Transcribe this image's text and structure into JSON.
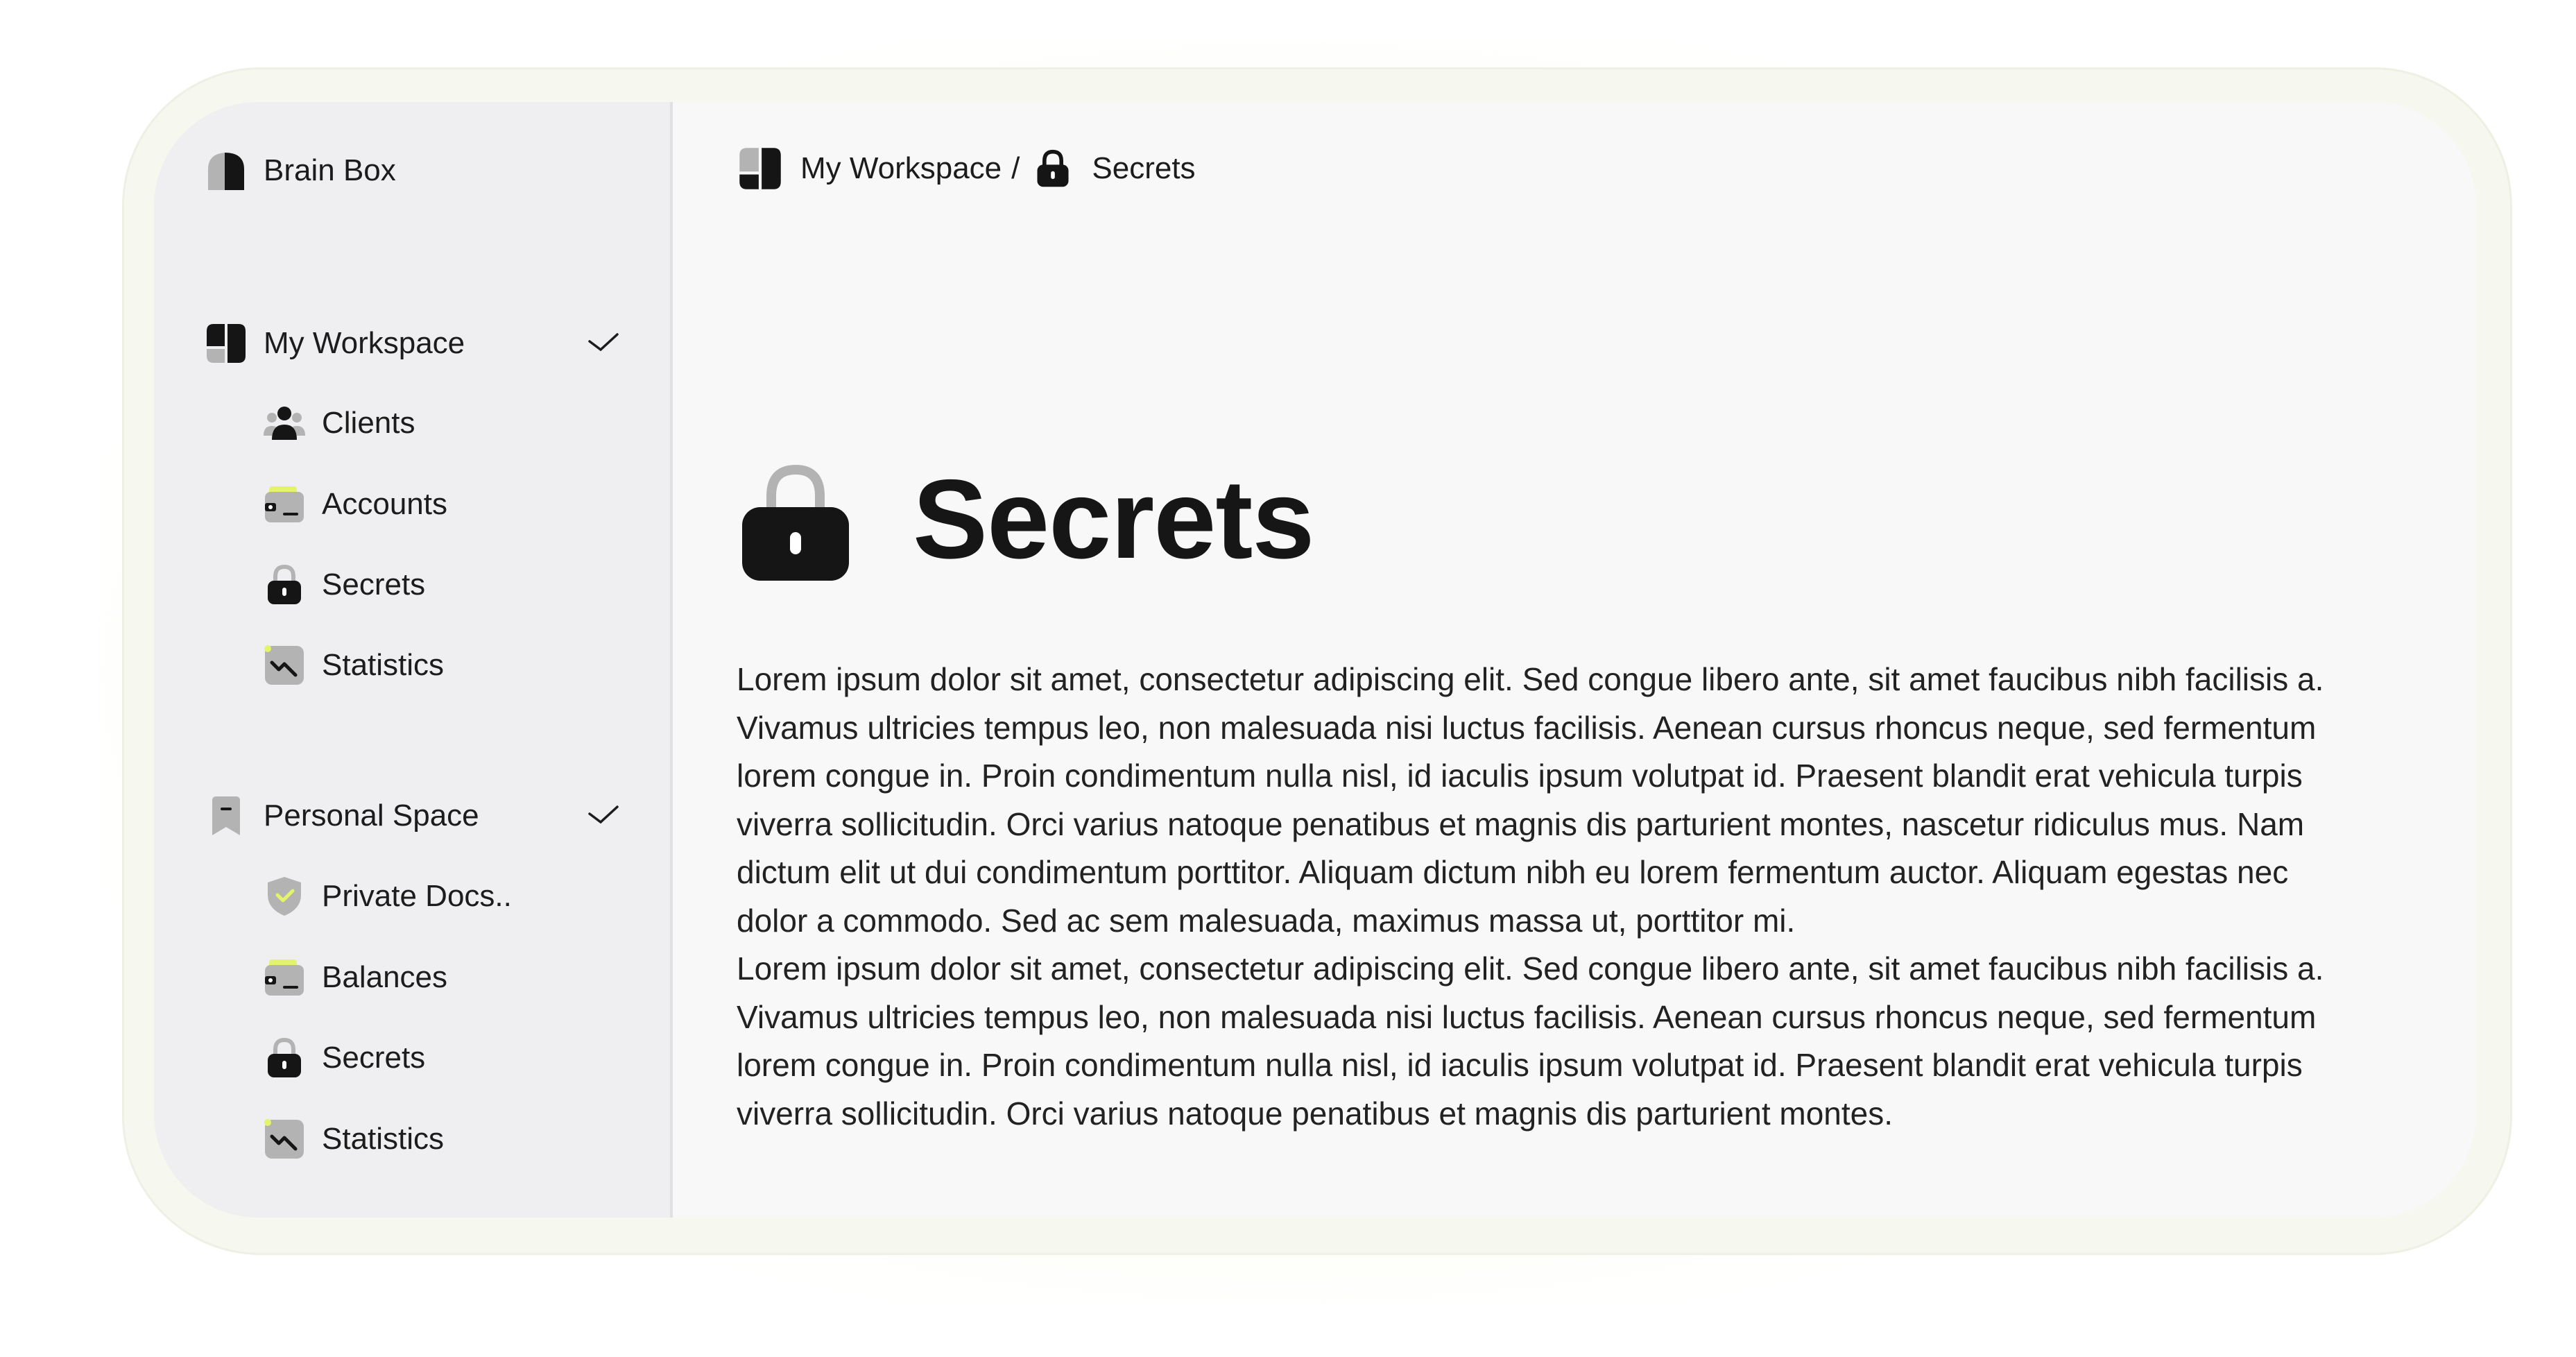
{
  "app": {
    "name": "Brain Box"
  },
  "sidebar": {
    "sections": [
      {
        "label": "My Workspace",
        "icon": "workspace-icon",
        "expanded": true,
        "items": [
          {
            "label": "Clients",
            "icon": "users-icon"
          },
          {
            "label": "Accounts",
            "icon": "wallet-icon"
          },
          {
            "label": "Secrets",
            "icon": "lock-icon"
          },
          {
            "label": "Statistics",
            "icon": "chart-icon"
          }
        ]
      },
      {
        "label": "Personal Space",
        "icon": "bookmark-icon",
        "expanded": true,
        "items": [
          {
            "label": "Private Docs..",
            "icon": "shield-icon"
          },
          {
            "label": "Balances",
            "icon": "wallet-icon"
          },
          {
            "label": "Secrets",
            "icon": "lock-icon"
          },
          {
            "label": "Statistics",
            "icon": "chart-icon"
          }
        ]
      }
    ]
  },
  "breadcrumb": {
    "workspace": "My Workspace",
    "separator": "/",
    "current": "Secrets"
  },
  "page": {
    "title": "Secrets",
    "paragraphs": [
      "Lorem ipsum dolor sit amet, consectetur adipiscing elit. Sed congue libero ante, sit amet faucibus nibh facilisis a. Vivamus ultricies tempus leo, non malesuada nisi luctus facilisis. Aenean cursus rhoncus neque, sed fermentum lorem congue in. Proin condimentum nulla nisl, id iaculis ipsum volutpat id. Praesent blandit erat vehicula turpis viverra sollicitudin. Orci varius natoque penatibus et magnis dis parturient montes, nascetur ridiculus mus. Nam dictum elit ut dui condimentum porttitor. Aliquam dictum nibh eu lorem fermentum auctor. Aliquam egestas nec dolor a commodo. Sed ac sem malesuada, maximus massa ut, porttitor mi.",
      "Lorem ipsum dolor sit amet, consectetur adipiscing elit. Sed congue libero ante, sit amet faucibus nibh facilisis a. Vivamus ultricies tempus leo, non malesuada nisi luctus facilisis. Aenean cursus rhoncus neque, sed fermentum lorem congue in. Proin condimentum nulla nisl, id iaculis ipsum volutpat id. Praesent blandit erat vehicula turpis viverra sollicitudin. Orci varius natoque penatibus et magnis dis parturient montes."
    ]
  },
  "colors": {
    "accent": "#e3f36a",
    "sidebar_bg": "#efeff1",
    "main_bg": "#f8f8f9",
    "icon_dark": "#151515",
    "icon_gray": "#b3b3b3"
  }
}
